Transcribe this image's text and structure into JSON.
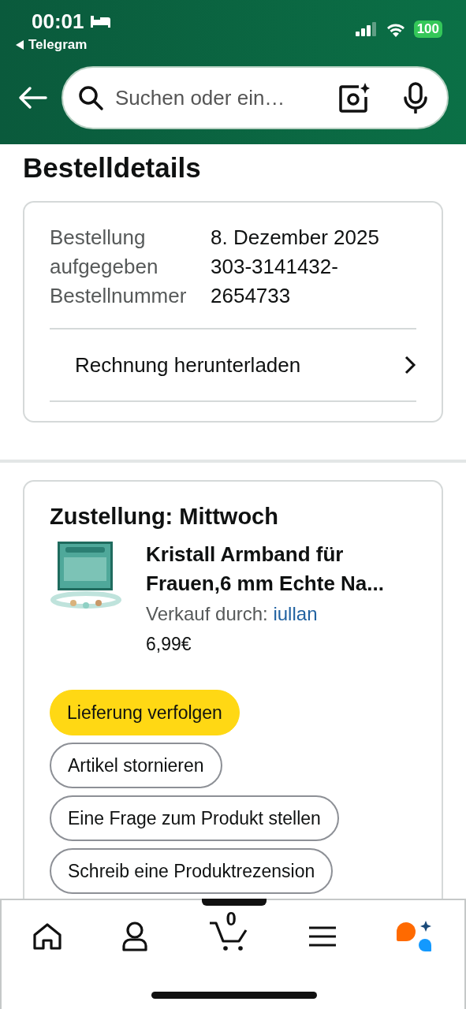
{
  "status_bar": {
    "time": "00:01",
    "back_app": "Telegram",
    "battery": "100"
  },
  "search": {
    "placeholder": "Suchen oder ein…"
  },
  "page_title": "Bestelldetails",
  "order_info": {
    "rows": [
      {
        "label": "Bestellung aufgegeben",
        "value": "8. Dezember 2025"
      },
      {
        "label": "Bestellnummer",
        "value": "303-3141432-2654733"
      }
    ],
    "invoice_link": "Rechnung herunterladen"
  },
  "delivery": {
    "heading": "Zustellung: Mittwoch",
    "product": {
      "title": "Kristall Armband für Frauen,6 mm Echte Na...",
      "seller_label": "Verkauf durch:",
      "seller": "iullan",
      "price": "6,99€"
    },
    "actions": [
      {
        "label": "Lieferung verfolgen",
        "kind": "primary"
      },
      {
        "label": "Artikel stornieren",
        "kind": "secondary"
      },
      {
        "label": "Eine Frage zum Produkt stellen",
        "kind": "secondary"
      },
      {
        "label": "Schreib eine Produktrezension",
        "kind": "secondary"
      }
    ]
  },
  "bottom_nav": {
    "cart_count": "0"
  }
}
